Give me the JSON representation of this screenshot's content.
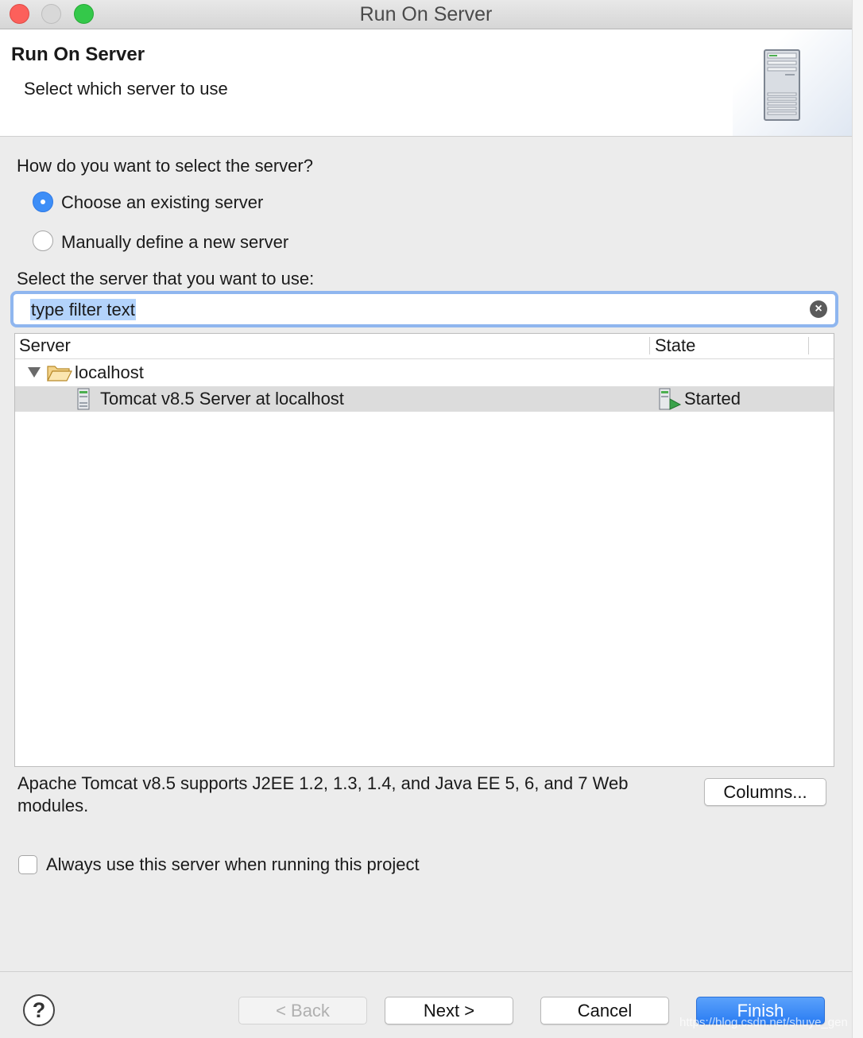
{
  "window": {
    "title": "Run On Server"
  },
  "header": {
    "title": "Run On Server",
    "subtitle": "Select which server to use",
    "icon": "server-icon"
  },
  "selection": {
    "question": "How do you want to select the server?",
    "options": [
      {
        "label": "Choose an existing server",
        "selected": true
      },
      {
        "label": "Manually define a new server",
        "selected": false
      }
    ],
    "list_label": "Select the server that you want to use:"
  },
  "filter": {
    "value": "type filter text",
    "placeholder": "type filter text",
    "clear_icon": "clear-icon"
  },
  "table": {
    "columns": [
      "Server",
      "State"
    ],
    "rows": [
      {
        "type": "folder",
        "name": "localhost",
        "expanded": true,
        "icon": "folder-open-icon"
      },
      {
        "type": "server",
        "name": "Tomcat v8.5 Server at localhost",
        "state": "Started",
        "icon": "server-small-icon",
        "state_icon": "server-started-icon",
        "selected": true
      }
    ]
  },
  "description": "Apache Tomcat v8.5 supports J2EE 1.2, 1.3, 1.4, and Java EE 5, 6, and 7 Web modules.",
  "columns_button": "Columns...",
  "always_use": {
    "label": "Always use this server when running this project",
    "checked": false
  },
  "footer": {
    "help_label": "?",
    "back_label": "< Back",
    "next_label": "Next >",
    "cancel_label": "Cancel",
    "finish_label": "Finish"
  },
  "watermark": "https://blog.csdn.net/shuye_gen",
  "colors": {
    "accent": "#3d8ef7",
    "focus_ring": "#8fb6ef",
    "selected_row": "#dcdcdc",
    "finish": "#2a7cf2"
  }
}
